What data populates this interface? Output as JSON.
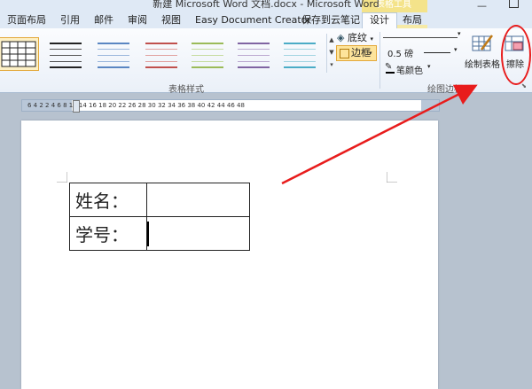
{
  "window": {
    "title": "新建 Microsoft Word 文档.docx - Microsoft Word",
    "context_header": "表格工具"
  },
  "tabs": [
    {
      "label": "页面布局"
    },
    {
      "label": "引用"
    },
    {
      "label": "邮件"
    },
    {
      "label": "审阅"
    },
    {
      "label": "视图"
    },
    {
      "label": "Easy Document Creator"
    },
    {
      "label": "保存到云笔记"
    },
    {
      "label": "设计"
    },
    {
      "label": "布局"
    }
  ],
  "ribbon": {
    "table_styles_group": "表格样式",
    "shading_label": "底纹",
    "border_label": "边框",
    "draw_borders_group": "绘图边框",
    "pen_weight": "0.5 磅",
    "pen_color_label": "笔颜色",
    "draw_table_label": "绘制表格",
    "eraser_label": "擦除"
  },
  "ruler": {
    "ticks": "6 4 2 2 4 6 8 12 14 16 18 20 22 26 28 30 32 34 36 38 40 42 44 46 48"
  },
  "document": {
    "table_rows": [
      {
        "label": "姓名："
      },
      {
        "label": "学号："
      }
    ]
  },
  "colors": {
    "annotation": "#e81c1c",
    "accent": "#e3a83a",
    "context_tab": "#f4e38a"
  }
}
